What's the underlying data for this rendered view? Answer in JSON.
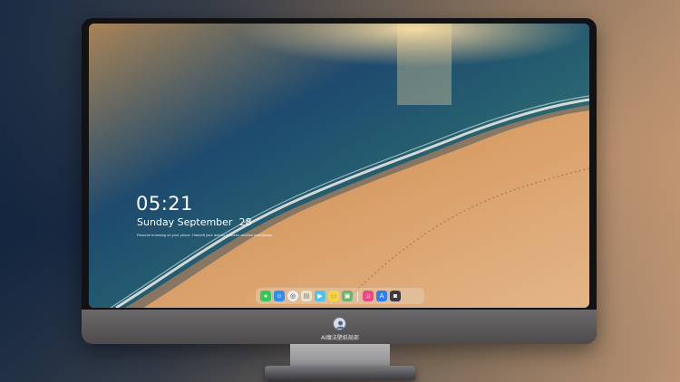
{
  "lock_screen": {
    "time": "05:21",
    "date": "Sunday September  28",
    "notice": "Resume browsing on your phone. Handoff your activity between devices seamlessly."
  },
  "monitor": {
    "chin_label": "AI魔法壁纸局部"
  },
  "dock": {
    "items": [
      {
        "name": "messages-icon",
        "color": "#35c75a",
        "glyph": "●"
      },
      {
        "name": "finder-icon",
        "color": "#2f8ff0",
        "glyph": "☺"
      },
      {
        "name": "safari-icon",
        "color": "#eeeeee",
        "glyph": "◎"
      },
      {
        "name": "notes-icon",
        "color": "#e8e2c9",
        "glyph": "▤"
      },
      {
        "name": "clips-icon",
        "color": "#4fc3e8",
        "glyph": "▶"
      },
      {
        "name": "stickies-icon",
        "color": "#f5d547",
        "glyph": "▭"
      },
      {
        "name": "preview-icon",
        "color": "#6fb26a",
        "glyph": "▣"
      },
      {
        "name": "music-icon",
        "color": "#e94b86",
        "glyph": "♫"
      },
      {
        "name": "app-store-icon",
        "color": "#2e7cf6",
        "glyph": "A"
      },
      {
        "name": "camera-icon",
        "color": "#3b3b40",
        "glyph": "◙"
      }
    ]
  },
  "colors": {
    "ocean_deep": "#1d4a6e",
    "ocean_teal": "#2d6e72",
    "sand": "#d49a63",
    "sun_glow": "#f4c98b"
  }
}
